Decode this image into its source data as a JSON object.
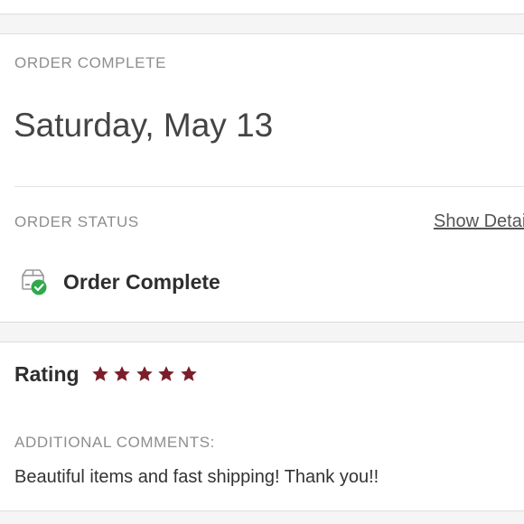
{
  "colors": {
    "accent_star": "#7b1e2c",
    "success_green": "#2eaa4a",
    "label_gray": "#8e8e8e"
  },
  "order": {
    "section_label": "ORDER COMPLETE",
    "date": "Saturday, May 13",
    "status_label": "ORDER STATUS",
    "show_details_link": "Show Details",
    "status_icon": "package-check-icon",
    "status_text": "Order Complete"
  },
  "review": {
    "rating_label": "Rating",
    "rating_value": 5,
    "rating_max": 5,
    "star_icon": "star-icon",
    "comments_label": "ADDITIONAL COMMENTS:",
    "comment": "Beautiful items and fast shipping! Thank you!!"
  }
}
